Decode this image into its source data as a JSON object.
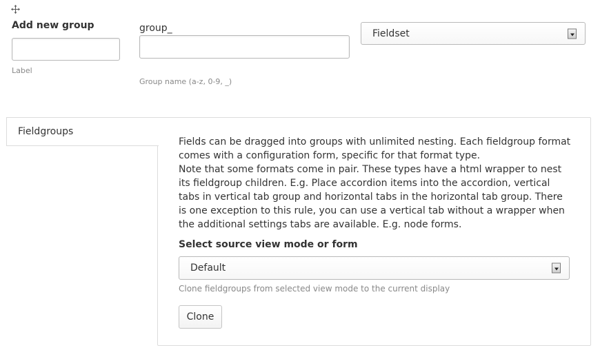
{
  "add_group": {
    "title": "Add new group",
    "label_value": "",
    "label_description": "Label",
    "name_prefix": "group_",
    "name_value": "",
    "name_description": "Group name (a-z, 0-9, _)",
    "format_selected": "Fieldset"
  },
  "icons": {
    "drag": "move-icon",
    "select_arrow": "dropdown-arrow-icon"
  },
  "vertical_tabs": {
    "tab_label": "Fieldgroups",
    "help_paragraph_1": "Fields can be dragged into groups with unlimited nesting. Each fieldgroup format comes with a configuration form, specific for that format type.",
    "help_paragraph_2": "Note that some formats come in pair. These types have a html wrapper to nest its fieldgroup children. E.g. Place accordion items into the accordion, vertical tabs in vertical tab group and horizontal tabs in the horizontal tab group. There is one exception to this rule, you can use a vertical tab without a wrapper when the additional settings tabs are available. E.g. node forms.",
    "source_label": "Select source view mode or form",
    "source_selected": "Default",
    "source_description": "Clone fieldgroups from selected view mode to the current display",
    "clone_button": "Clone"
  }
}
